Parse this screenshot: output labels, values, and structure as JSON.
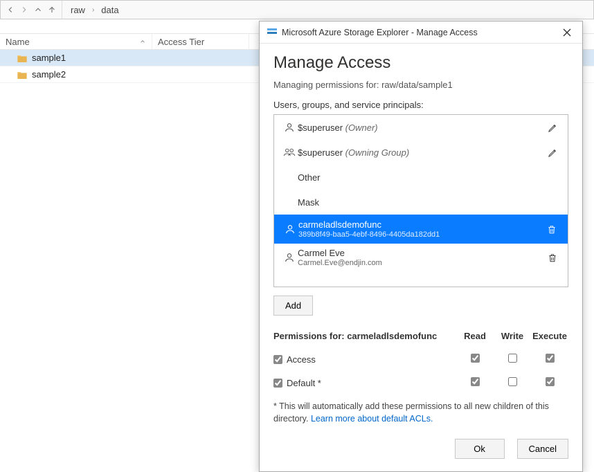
{
  "breadcrumb": {
    "parts": [
      "raw",
      "data"
    ]
  },
  "filelist": {
    "columns": {
      "name": "Name",
      "tier": "Access Tier"
    },
    "rows": [
      {
        "name": "sample1",
        "selected": true
      },
      {
        "name": "sample2",
        "selected": false
      }
    ]
  },
  "dialog": {
    "window_title": "Microsoft Azure Storage Explorer - Manage Access",
    "heading": "Manage Access",
    "subheading": "Managing permissions for: raw/data/sample1",
    "list_label": "Users, groups, and service principals:",
    "principals": [
      {
        "type": "user",
        "name": "$superuser",
        "role": "(Owner)",
        "action": "edit"
      },
      {
        "type": "group",
        "name": "$superuser",
        "role": "(Owning Group)",
        "action": "edit"
      },
      {
        "type": "none",
        "name": "Other"
      },
      {
        "type": "none",
        "name": "Mask"
      },
      {
        "type": "user",
        "name": "carmeladlsdemofunc",
        "sub": "389b8f49-baa5-4ebf-8496-4405da182dd1",
        "action": "delete",
        "selected": true
      },
      {
        "type": "user",
        "name": "Carmel Eve",
        "sub": "Carmel.Eve@endjin.com",
        "action": "delete"
      }
    ],
    "add_label": "Add",
    "perm_title_prefix": "Permissions for: ",
    "perm_subject": "carmeladlsdemofunc",
    "perm_cols": {
      "read": "Read",
      "write": "Write",
      "execute": "Execute"
    },
    "perm_rows": [
      {
        "label": "Access",
        "checked": true,
        "read": true,
        "write": false,
        "execute": true
      },
      {
        "label": "Default *",
        "checked": true,
        "read": true,
        "write": false,
        "execute": true
      }
    ],
    "footnote_prefix": "* This will automatically add these permissions to all new children of this directory. ",
    "footnote_link": "Learn more about default ACLs.",
    "ok_label": "Ok",
    "cancel_label": "Cancel"
  }
}
